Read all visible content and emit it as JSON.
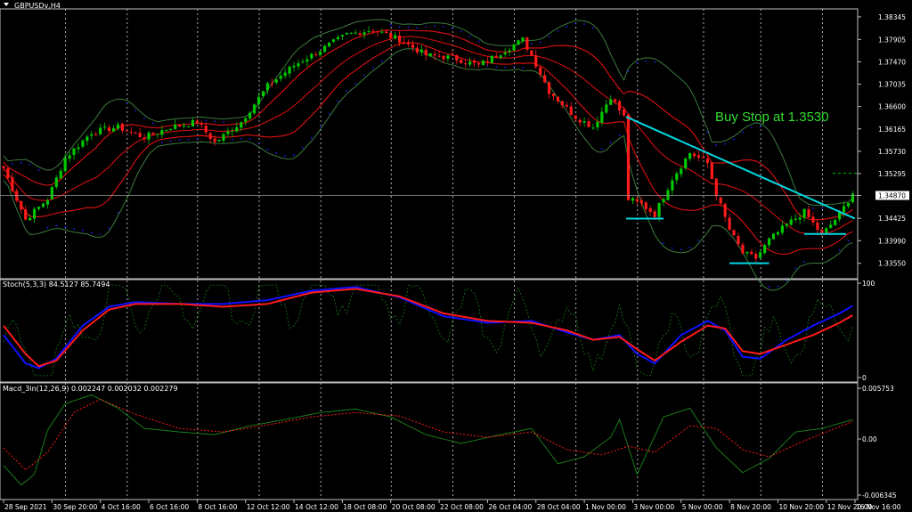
{
  "colors": {
    "background": "#000000",
    "grid": "#ffffff",
    "frame": "#c0c0c0",
    "bull": "#00c800",
    "bear": "#ff1a1a",
    "bb_outer": "#3c7a3c",
    "bb_inner": "#e01010",
    "psar": "#2020ff",
    "trendline": "#00d8e0",
    "support": "#00d8e0",
    "stoch_main": "#1010ff",
    "stoch_signal": "#ff1a1a",
    "stoch_raw": "#1a7a1a",
    "macd_line": "#1a7a1a",
    "macd_signal": "#ff1a1a",
    "annotation": "#33dd33"
  },
  "chart_data": [
    {
      "type": "candlestick",
      "title": "GBPUSDv,H4",
      "yticks": [
        "1.38345",
        "1.37905",
        "1.37470",
        "1.37035",
        "1.36600",
        "1.36165",
        "1.35730",
        "1.35295",
        "1.34870",
        "1.34425",
        "1.33990",
        "1.33550"
      ],
      "ylim": [
        1.3325,
        1.385
      ],
      "current_price": "1.34870",
      "annotation": "Buy Stop at 1.3530",
      "buy_stop_level": 1.353,
      "trendline": [
        [
          141.5,
          1.364
        ],
        [
          193.5,
          1.3442
        ]
      ],
      "support_lines": [
        {
          "x_from": 141.5,
          "x_to": 150.0,
          "y": 1.3442
        },
        {
          "x_from": 165.0,
          "x_to": 174.0,
          "y": 1.3355
        },
        {
          "x_from": 182.0,
          "x_to": 191.5,
          "y": 1.3412
        }
      ],
      "series": [
        {
          "name": "close",
          "keys": [
            [
              0,
              1.354
            ],
            [
              5,
              1.344
            ],
            [
              10,
              1.348
            ],
            [
              14,
              1.356
            ],
            [
              20,
              1.361
            ],
            [
              26,
              1.362
            ],
            [
              32,
              1.36
            ],
            [
              38,
              1.362
            ],
            [
              44,
              1.363
            ],
            [
              48,
              1.359
            ],
            [
              54,
              1.363
            ],
            [
              60,
              1.37
            ],
            [
              66,
              1.374
            ],
            [
              72,
              1.377
            ],
            [
              78,
              1.38
            ],
            [
              84,
              1.381
            ],
            [
              90,
              1.379
            ],
            [
              96,
              1.376
            ],
            [
              102,
              1.3755
            ],
            [
              108,
              1.374
            ],
            [
              114,
              1.377
            ],
            [
              118,
              1.379
            ],
            [
              120,
              1.376
            ],
            [
              124,
              1.369
            ],
            [
              130,
              1.364
            ],
            [
              134,
              1.362
            ],
            [
              138,
              1.368
            ],
            [
              141,
              1.364
            ],
            [
              142,
              1.348
            ],
            [
              145,
              1.347
            ],
            [
              148,
              1.345
            ],
            [
              152,
              1.352
            ],
            [
              156,
              1.357
            ],
            [
              160,
              1.355
            ],
            [
              162,
              1.349
            ],
            [
              165,
              1.342
            ],
            [
              168,
              1.3375
            ],
            [
              171,
              1.3365
            ],
            [
              174,
              1.34
            ],
            [
              178,
              1.343
            ],
            [
              182,
              1.3455
            ],
            [
              186,
              1.341
            ],
            [
              190,
              1.345
            ],
            [
              193,
              1.3492
            ]
          ]
        }
      ]
    },
    {
      "type": "line",
      "title": "Stoch(5,3,3) 84.5127 85.7494",
      "yticks": [
        "100",
        "0"
      ],
      "ylim": [
        0,
        100
      ],
      "series": [
        {
          "name": "main",
          "keys": [
            [
              0,
              45
            ],
            [
              5,
              15
            ],
            [
              8,
              10
            ],
            [
              12,
              20
            ],
            [
              18,
              55
            ],
            [
              24,
              75
            ],
            [
              30,
              80
            ],
            [
              40,
              78
            ],
            [
              50,
              78
            ],
            [
              60,
              82
            ],
            [
              70,
              92
            ],
            [
              80,
              96
            ],
            [
              90,
              85
            ],
            [
              100,
              65
            ],
            [
              110,
              58
            ],
            [
              120,
              60
            ],
            [
              128,
              48
            ],
            [
              134,
              40
            ],
            [
              140,
              45
            ],
            [
              144,
              25
            ],
            [
              148,
              15
            ],
            [
              154,
              45
            ],
            [
              160,
              60
            ],
            [
              164,
              50
            ],
            [
              168,
              22
            ],
            [
              172,
              20
            ],
            [
              178,
              40
            ],
            [
              184,
              55
            ],
            [
              190,
              68
            ],
            [
              193,
              76
            ]
          ]
        },
        {
          "name": "signal",
          "keys": [
            [
              0,
              55
            ],
            [
              5,
              25
            ],
            [
              8,
              12
            ],
            [
              12,
              18
            ],
            [
              18,
              50
            ],
            [
              24,
              72
            ],
            [
              30,
              78
            ],
            [
              40,
              78
            ],
            [
              50,
              75
            ],
            [
              60,
              78
            ],
            [
              70,
              90
            ],
            [
              80,
              94
            ],
            [
              90,
              86
            ],
            [
              100,
              68
            ],
            [
              110,
              60
            ],
            [
              120,
              58
            ],
            [
              128,
              50
            ],
            [
              134,
              40
            ],
            [
              140,
              43
            ],
            [
              144,
              30
            ],
            [
              148,
              18
            ],
            [
              154,
              38
            ],
            [
              160,
              55
            ],
            [
              164,
              52
            ],
            [
              168,
              28
            ],
            [
              172,
              25
            ],
            [
              178,
              35
            ],
            [
              184,
              45
            ],
            [
              190,
              58
            ],
            [
              193,
              66
            ]
          ]
        }
      ]
    },
    {
      "type": "line",
      "title": "Macd_3in(12,26,9) 0.002247 0.002032 0.002279",
      "yticks": [
        "0.005753",
        "0.00",
        "-0.006345"
      ],
      "ylim": [
        -0.006345,
        0.005753
      ],
      "series": [
        {
          "name": "macd",
          "keys": [
            [
              0,
              -0.003
            ],
            [
              4,
              -0.0052
            ],
            [
              7,
              -0.004
            ],
            [
              10,
              0.001
            ],
            [
              14,
              0.004
            ],
            [
              20,
              0.005
            ],
            [
              26,
              0.0035
            ],
            [
              32,
              0.0012
            ],
            [
              40,
              0.0008
            ],
            [
              48,
              0.0005
            ],
            [
              56,
              0.0015
            ],
            [
              64,
              0.0022
            ],
            [
              72,
              0.003
            ],
            [
              80,
              0.0034
            ],
            [
              88,
              0.0025
            ],
            [
              96,
              0.0005
            ],
            [
              104,
              -0.0005
            ],
            [
              112,
              0.0004
            ],
            [
              120,
              0.0012
            ],
            [
              126,
              -0.0028
            ],
            [
              132,
              -0.002
            ],
            [
              138,
              0.0002
            ],
            [
              140,
              0.0022
            ],
            [
              144,
              -0.004
            ],
            [
              150,
              0.0025
            ],
            [
              156,
              0.0035
            ],
            [
              162,
              -0.001
            ],
            [
              168,
              -0.0038
            ],
            [
              174,
              -0.0022
            ],
            [
              180,
              0.0008
            ],
            [
              186,
              0.0012
            ],
            [
              193,
              0.0022
            ]
          ]
        },
        {
          "name": "signal",
          "keys": [
            [
              0,
              -0.001
            ],
            [
              5,
              -0.0035
            ],
            [
              10,
              -0.0015
            ],
            [
              16,
              0.003
            ],
            [
              22,
              0.0045
            ],
            [
              30,
              0.0028
            ],
            [
              40,
              0.0012
            ],
            [
              50,
              0.0008
            ],
            [
              60,
              0.0016
            ],
            [
              70,
              0.0025
            ],
            [
              80,
              0.003
            ],
            [
              90,
              0.0026
            ],
            [
              100,
              0.0008
            ],
            [
              110,
              0.0002
            ],
            [
              120,
              0.0008
            ],
            [
              128,
              -0.0012
            ],
            [
              136,
              -0.0018
            ],
            [
              142,
              -0.0008
            ],
            [
              148,
              -0.0015
            ],
            [
              156,
              0.0015
            ],
            [
              162,
              0.0012
            ],
            [
              168,
              -0.0012
            ],
            [
              174,
              -0.002
            ],
            [
              182,
              -0.0002
            ],
            [
              188,
              0.001
            ],
            [
              193,
              0.002
            ]
          ]
        }
      ]
    }
  ],
  "time_axis": {
    "labels": [
      {
        "bar": 0,
        "text": "28 Sep 2021"
      },
      {
        "bar": 11,
        "text": "30 Sep 20:00"
      },
      {
        "bar": 22,
        "text": "4 Oct 16:00"
      },
      {
        "bar": 33,
        "text": "6 Oct 16:00"
      },
      {
        "bar": 44,
        "text": "8 Oct 16:00"
      },
      {
        "bar": 55,
        "text": "12 Oct 12:00"
      },
      {
        "bar": 66,
        "text": "14 Oct 12:00"
      },
      {
        "bar": 77,
        "text": "18 Oct 08:00"
      },
      {
        "bar": 88,
        "text": "20 Oct 08:00"
      },
      {
        "bar": 99,
        "text": "22 Oct 08:00"
      },
      {
        "bar": 110,
        "text": "26 Oct 04:00"
      },
      {
        "bar": 121,
        "text": "28 Oct 04:00"
      },
      {
        "bar": 132,
        "text": "1 Nov 00:00"
      },
      {
        "bar": 143,
        "text": "3 Nov 00:00"
      },
      {
        "bar": 154,
        "text": "5 Nov 00:00"
      },
      {
        "bar": 165,
        "text": "8 Nov 20:00"
      },
      {
        "bar": 176,
        "text": "10 Nov 20:00"
      },
      {
        "bar": 187,
        "text": "12 Nov 20:00"
      },
      {
        "bar": 198,
        "text": "16 Nov 16:00"
      }
    ],
    "gridlines": [
      14,
      28,
      44,
      58,
      72,
      88,
      102,
      116,
      130,
      144,
      159,
      172,
      186
    ]
  }
}
